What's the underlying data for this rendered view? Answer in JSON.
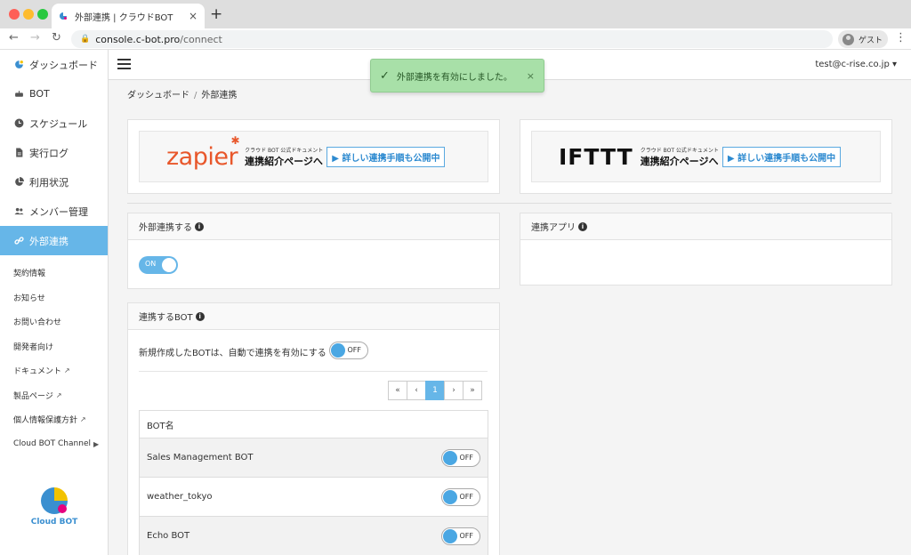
{
  "browser": {
    "tab_title": "外部連携 | クラウドBOT",
    "tab_close": "×",
    "new_tab": "+",
    "url_host": "console.c-bot.pro",
    "url_path": "/connect",
    "profile_label": "ゲスト",
    "nav": {
      "back": "←",
      "forward": "→",
      "reload": "↻",
      "menu": "⋮"
    }
  },
  "sidebar": {
    "items": [
      {
        "label": "ダッシュボード",
        "icon": "cloudbot-logo-icon"
      },
      {
        "label": "BOT",
        "icon": "robot-icon"
      },
      {
        "label": "スケジュール",
        "icon": "clock-icon"
      },
      {
        "label": "実行ログ",
        "icon": "file-icon"
      },
      {
        "label": "利用状況",
        "icon": "pie-chart-icon"
      },
      {
        "label": "メンバー管理",
        "icon": "users-icon"
      },
      {
        "label": "外部連携",
        "icon": "link-icon",
        "active": true
      }
    ],
    "links": [
      {
        "label": "契約情報",
        "external": false
      },
      {
        "label": "お知らせ",
        "external": false
      },
      {
        "label": "お問い合わせ",
        "external": false
      },
      {
        "label": "開発者向け",
        "external": false
      },
      {
        "label": "ドキュメント",
        "external": true
      },
      {
        "label": "製品ページ",
        "external": true
      },
      {
        "label": "個人情報保護方針",
        "external": true
      },
      {
        "label": "Cloud BOT Channel",
        "external": true
      }
    ],
    "logo_text": "Cloud BOT"
  },
  "header": {
    "user_email": "test@c-rise.co.jp ▾"
  },
  "toast": {
    "message": "外部連携を有効にしました。",
    "close": "×"
  },
  "breadcrumb": {
    "home": "ダッシュボード",
    "sep": "/",
    "current": "外部連携"
  },
  "banners": {
    "zapier": {
      "logo": "zapier",
      "sub": "クラウド BOT 公式ドキュメント",
      "main": "連携紹介ページへ",
      "button": "▶ 詳しい連携手順も公開中"
    },
    "ifttt": {
      "logo": "IFTTT",
      "sub": "クラウド BOT 公式ドキュメント",
      "main": "連携紹介ページへ",
      "button": "▶ 詳しい連携手順も公開中"
    }
  },
  "integration": {
    "title": "外部連携する",
    "toggle_label": "ON",
    "enabled": true
  },
  "apps": {
    "title": "連携アプリ"
  },
  "bots": {
    "title": "連携するBOT",
    "auto_label": "新規作成したBOTは、自動で連携を有効にする",
    "auto_toggle": "OFF",
    "pager": {
      "first": "«",
      "prev": "‹",
      "current": "1",
      "next": "›",
      "last": "»"
    },
    "column": "BOT名",
    "rows": [
      {
        "name": "Sales Management BOT",
        "toggle": "OFF"
      },
      {
        "name": "weather_tokyo",
        "toggle": "OFF"
      },
      {
        "name": "Echo BOT",
        "toggle": "OFF"
      }
    ]
  },
  "colors": {
    "accent": "#66b6e8",
    "toast_bg": "#a8e0a8",
    "zapier": "#e8572b"
  }
}
